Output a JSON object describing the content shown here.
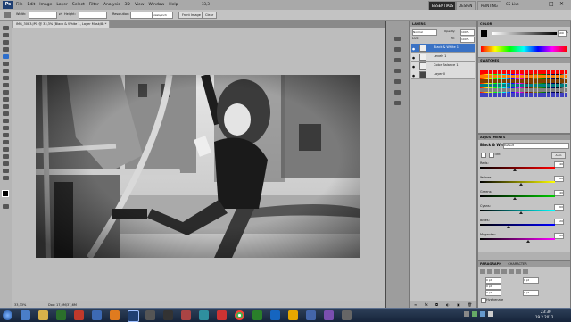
{
  "app": {
    "logo": "Ps",
    "menu": [
      "File",
      "Edit",
      "Image",
      "Layer",
      "Select",
      "Filter",
      "Analysis",
      "3D",
      "View",
      "Window",
      "Help"
    ],
    "zoom": "33,3",
    "workspaces": [
      "ESSENTIALS",
      "DESIGN",
      "PAINTING"
    ],
    "cs_live": "CS Live"
  },
  "options": {
    "width_label": "Width:",
    "height_label": "Height:",
    "resolution_label": "Resolution:",
    "resolution_unit": "pixels/inch",
    "front_image": "Front Image",
    "clear": "Clear"
  },
  "document": {
    "tab": "IMG_3083.JPG @ 33,3% (Black & White 1, Layer Mask/8) *",
    "zoom_status": "33,33%",
    "doc_status": "Doc: 17,0M/37,6M"
  },
  "layers": {
    "title": "LAYERS",
    "blend_mode": "Normal",
    "opacity_label": "Opacity:",
    "opacity": "100%",
    "lock_label": "Lock:",
    "fill_label": "Fill:",
    "fill": "100%",
    "items": [
      {
        "name": "Black & White 1",
        "selected": true
      },
      {
        "name": "Levels 1",
        "selected": false
      },
      {
        "name": "Color Balance 1",
        "selected": false
      },
      {
        "name": "Layer 0",
        "selected": false
      }
    ]
  },
  "color": {
    "title": "COLOR",
    "value": "100",
    "unit": "%"
  },
  "swatches": {
    "title": "SWATCHES"
  },
  "adjustments": {
    "title": "ADJUSTMENTS",
    "name": "Black & White",
    "preset": "Default",
    "tint_label": "Tint",
    "auto_label": "Auto",
    "sliders": [
      {
        "label": "Reds:",
        "value": 40,
        "gradient": "linear-gradient(90deg,#000,#f00)",
        "pos": 0.47
      },
      {
        "label": "Yellows:",
        "value": 60,
        "gradient": "linear-gradient(90deg,#000,#ff0)",
        "pos": 0.55
      },
      {
        "label": "Greens:",
        "value": 40,
        "gradient": "linear-gradient(90deg,#000,#0c0)",
        "pos": 0.47
      },
      {
        "label": "Cyans:",
        "value": 60,
        "gradient": "linear-gradient(90deg,#000,#0ff)",
        "pos": 0.55
      },
      {
        "label": "Blues:",
        "value": 20,
        "gradient": "linear-gradient(90deg,#000,#00f)",
        "pos": 0.38
      },
      {
        "label": "Magentas:",
        "value": 80,
        "gradient": "linear-gradient(90deg,#000,#f0f)",
        "pos": 0.64
      }
    ]
  },
  "paragraph": {
    "tabs": [
      "PARAGRAPH",
      "CHARACTER"
    ],
    "indent_value_1": "0 pt",
    "indent_value_2": "0 pt",
    "indent_value_3": "0 pt",
    "space_value_1": "0 pt",
    "space_value_2": "0 pt",
    "hyphenate": "Hyphenate"
  },
  "taskbar": {
    "time": "23:30",
    "date": "19.2.2012."
  }
}
